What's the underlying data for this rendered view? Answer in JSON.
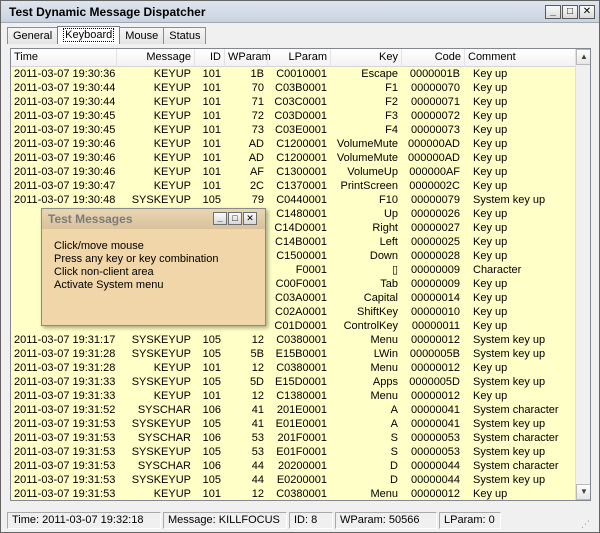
{
  "window": {
    "title": "Test Dynamic Message Dispatcher"
  },
  "tabs": [
    "General",
    "Keyboard",
    "Mouse",
    "Status"
  ],
  "active_tab": "Keyboard",
  "columns": [
    "Time",
    "Message",
    "ID",
    "WParam",
    "LParam",
    "Key",
    "Code",
    "Comment"
  ],
  "rows": [
    [
      "2011-03-07 19:30:36",
      "KEYUP",
      "101",
      "1B",
      "C0010001",
      "Escape",
      "0000001B",
      "Key up"
    ],
    [
      "2011-03-07 19:30:44",
      "KEYUP",
      "101",
      "70",
      "C03B0001",
      "F1",
      "00000070",
      "Key up"
    ],
    [
      "2011-03-07 19:30:44",
      "KEYUP",
      "101",
      "71",
      "C03C0001",
      "F2",
      "00000071",
      "Key up"
    ],
    [
      "2011-03-07 19:30:45",
      "KEYUP",
      "101",
      "72",
      "C03D0001",
      "F3",
      "00000072",
      "Key up"
    ],
    [
      "2011-03-07 19:30:45",
      "KEYUP",
      "101",
      "73",
      "C03E0001",
      "F4",
      "00000073",
      "Key up"
    ],
    [
      "2011-03-07 19:30:46",
      "KEYUP",
      "101",
      "AD",
      "C1200001",
      "VolumeMute",
      "000000AD",
      "Key up"
    ],
    [
      "2011-03-07 19:30:46",
      "KEYUP",
      "101",
      "AD",
      "C1200001",
      "VolumeMute",
      "000000AD",
      "Key up"
    ],
    [
      "2011-03-07 19:30:46",
      "KEYUP",
      "101",
      "AF",
      "C1300001",
      "VolumeUp",
      "000000AF",
      "Key up"
    ],
    [
      "2011-03-07 19:30:47",
      "KEYUP",
      "101",
      "2C",
      "C1370001",
      "PrintScreen",
      "0000002C",
      "Key up"
    ],
    [
      "2011-03-07 19:30:48",
      "SYSKEYUP",
      "105",
      "79",
      "C0440001",
      "F10",
      "00000079",
      "System key up"
    ],
    [
      "",
      "",
      "",
      "",
      "C1480001",
      "Up",
      "00000026",
      "Key up"
    ],
    [
      "",
      "",
      "",
      "",
      "C14D0001",
      "Right",
      "00000027",
      "Key up"
    ],
    [
      "",
      "",
      "",
      "",
      "C14B0001",
      "Left",
      "00000025",
      "Key up"
    ],
    [
      "",
      "",
      "",
      "",
      "C1500001",
      "Down",
      "00000028",
      "Key up"
    ],
    [
      "",
      "",
      "",
      "",
      "F0001",
      "▯",
      "00000009",
      "Character"
    ],
    [
      "",
      "",
      "",
      "",
      "C00F0001",
      "Tab",
      "00000009",
      "Key up"
    ],
    [
      "",
      "",
      "",
      "",
      "C03A0001",
      "Capital",
      "00000014",
      "Key up"
    ],
    [
      "",
      "",
      "",
      "",
      "C02A0001",
      "ShiftKey",
      "00000010",
      "Key up"
    ],
    [
      "",
      "",
      "",
      "",
      "C01D0001",
      "ControlKey",
      "00000011",
      "Key up"
    ],
    [
      "2011-03-07 19:31:17",
      "SYSKEYUP",
      "105",
      "12",
      "C0380001",
      "Menu",
      "00000012",
      "System key up"
    ],
    [
      "2011-03-07 19:31:28",
      "SYSKEYUP",
      "105",
      "5B",
      "E15B0001",
      "LWin",
      "0000005B",
      "System key up"
    ],
    [
      "2011-03-07 19:31:28",
      "KEYUP",
      "101",
      "12",
      "C0380001",
      "Menu",
      "00000012",
      "Key up"
    ],
    [
      "2011-03-07 19:31:33",
      "SYSKEYUP",
      "105",
      "5D",
      "E15D0001",
      "Apps",
      "0000005D",
      "System key up"
    ],
    [
      "2011-03-07 19:31:33",
      "KEYUP",
      "101",
      "12",
      "C1380001",
      "Menu",
      "00000012",
      "Key up"
    ],
    [
      "2011-03-07 19:31:52",
      "SYSCHAR",
      "106",
      "41",
      "201E0001",
      "A",
      "00000041",
      "System character"
    ],
    [
      "2011-03-07 19:31:53",
      "SYSKEYUP",
      "105",
      "41",
      "E01E0001",
      "A",
      "00000041",
      "System key up"
    ],
    [
      "2011-03-07 19:31:53",
      "SYSCHAR",
      "106",
      "53",
      "201F0001",
      "S",
      "00000053",
      "System character"
    ],
    [
      "2011-03-07 19:31:53",
      "SYSKEYUP",
      "105",
      "53",
      "E01F0001",
      "S",
      "00000053",
      "System key up"
    ],
    [
      "2011-03-07 19:31:53",
      "SYSCHAR",
      "106",
      "44",
      "20200001",
      "D",
      "00000044",
      "System character"
    ],
    [
      "2011-03-07 19:31:53",
      "SYSKEYUP",
      "105",
      "44",
      "E0200001",
      "D",
      "00000044",
      "System key up"
    ],
    [
      "2011-03-07 19:31:53",
      "KEYUP",
      "101",
      "12",
      "C0380001",
      "Menu",
      "00000012",
      "Key up"
    ]
  ],
  "dialog": {
    "title": "Test Messages",
    "lines": [
      "Click/move mouse",
      "Press any key or key combination",
      "Click non-client area",
      "Activate System menu"
    ]
  },
  "status": {
    "time": "Time: 2011-03-07 19:32:18",
    "message": "Message: KILLFOCUS",
    "id": "ID: 8",
    "wparam": "WParam: 50566",
    "lparam": "LParam: 0"
  },
  "colors": {
    "list_background": "#ffffc8",
    "dialog_background": "#f0d6a8"
  },
  "icons": [
    "minimize-icon",
    "maximize-icon",
    "close-icon",
    "scroll-up-icon",
    "scroll-down-icon",
    "size-grip-icon"
  ]
}
